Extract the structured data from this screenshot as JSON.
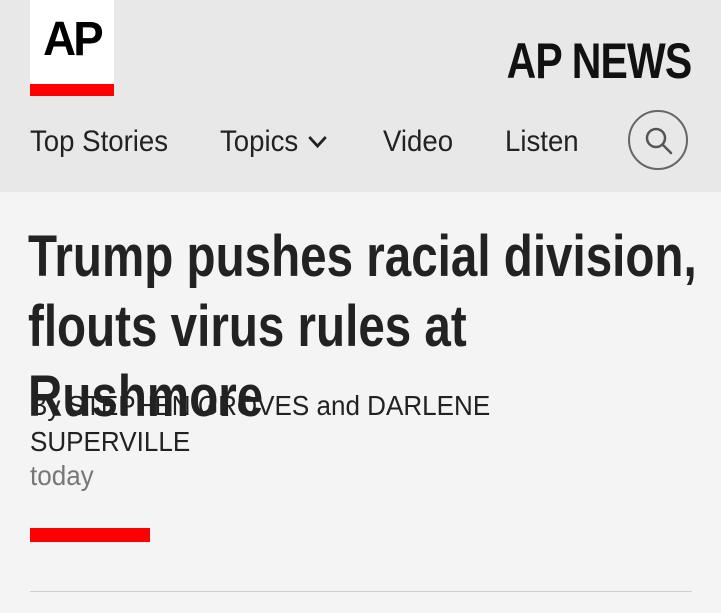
{
  "header": {
    "logo_text": "AP",
    "brand": "AP NEWS",
    "nav": [
      {
        "label": "Top Stories"
      },
      {
        "label": "Topics"
      },
      {
        "label": "Video"
      },
      {
        "label": "Listen"
      }
    ],
    "search_icon": "search-icon",
    "accent_color": "#ff0000"
  },
  "article": {
    "headline": "Trump pushes racial division, flouts virus rules at Rushmore",
    "byline": "By STEPHEN GROVES and DARLENE SUPERVILLE",
    "date": "today"
  }
}
